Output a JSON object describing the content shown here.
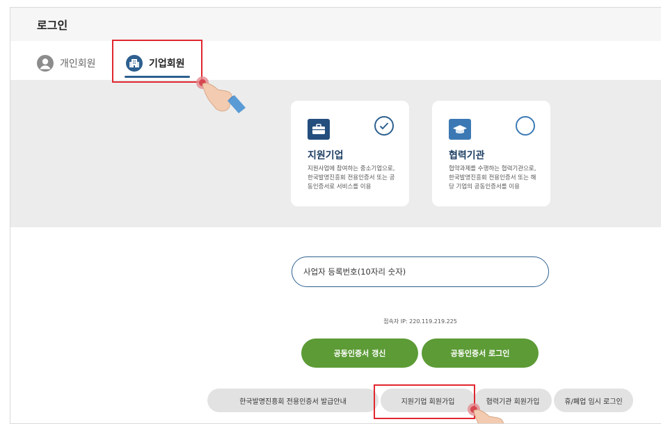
{
  "page": {
    "title": "로그인"
  },
  "tabs": [
    {
      "label": "개인회원",
      "active": false
    },
    {
      "label": "기업회원",
      "active": true
    }
  ],
  "member_types": [
    {
      "title": "지원기업",
      "description": "지원사업에 참여하는 중소기업으로, 한국발명진흥회 전용인증서 또는 공동인증서로 서비스를 이용",
      "selected": true,
      "icon": "briefcase-icon"
    },
    {
      "title": "협력기관",
      "description": "협약과제를 수행하는 협력기관으로, 한국발명진흥회 전용인증서 또는 해당 기업의 공동인증서를 이용",
      "selected": false,
      "icon": "graduation-cap-icon"
    }
  ],
  "form": {
    "business_number_placeholder": "사업자 등록번호(10자리 숫자)",
    "ip_text": "접속자 IP: 220.119.219.225"
  },
  "buttons": {
    "renew_cert": "공동인증서 갱신",
    "cert_login": "공동인증서 로그인",
    "cert_guide": "한국발명진흥회 전용인증서 발급안내",
    "support_signup": "지원기업 회원가입",
    "partner_signup": "협력기관 회원가입",
    "closed_login": "휴/폐업 임시 로그인"
  },
  "colors": {
    "accent_navy": "#2d5f8f",
    "green": "#5c9b36",
    "highlight_red": "#e0262e"
  }
}
